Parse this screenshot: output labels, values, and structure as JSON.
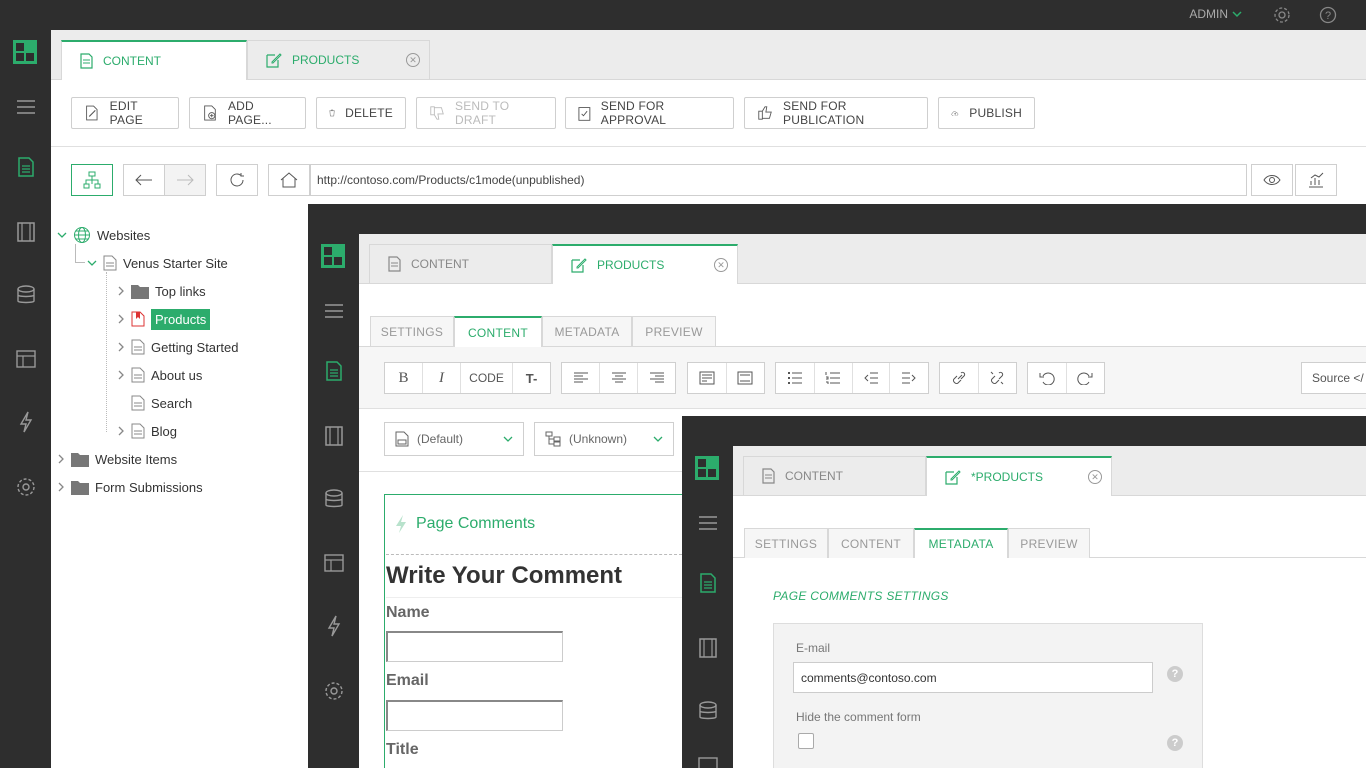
{
  "top": {
    "admin_label": "ADMIN"
  },
  "w1": {
    "tabs": [
      {
        "label": "CONTENT"
      },
      {
        "label": "PRODUCTS"
      }
    ],
    "toolbar": {
      "edit_page": "EDIT PAGE",
      "add_page": "ADD PAGE...",
      "delete": "DELETE",
      "send_to_draft": "SEND TO DRAFT",
      "send_for_approval": "SEND FOR APPROVAL",
      "send_for_publication": "SEND FOR PUBLICATION",
      "publish": "PUBLISH"
    },
    "address": "http://contoso.com/Products/c1mode(unpublished)",
    "tree": {
      "websites": "Websites",
      "venus": "Venus Starter Site",
      "top_links": "Top links",
      "products": "Products",
      "getting_started": "Getting Started",
      "about_us": "About us",
      "search": "Search",
      "blog": "Blog",
      "website_items": "Website Items",
      "form_submissions": "Form Submissions"
    }
  },
  "w2": {
    "tabs": [
      {
        "label": "CONTENT"
      },
      {
        "label": "PRODUCTS"
      }
    ],
    "subtabs": [
      "SETTINGS",
      "CONTENT",
      "METADATA",
      "PREVIEW"
    ],
    "editor": {
      "code": "CODE",
      "source": "Source </"
    },
    "dropdowns": {
      "template": "(Default)",
      "layout": "(Unknown)"
    },
    "preview": {
      "widget_title": "Page Comments",
      "heading": "Write Your Comment",
      "name_label": "Name",
      "email_label": "Email",
      "title_label": "Title"
    }
  },
  "w3": {
    "tabs": [
      {
        "label": "CONTENT"
      },
      {
        "label": "*PRODUCTS"
      }
    ],
    "subtabs": [
      "SETTINGS",
      "CONTENT",
      "METADATA",
      "PREVIEW"
    ],
    "section_title": "PAGE COMMENTS SETTINGS",
    "email_label": "E-mail",
    "email_value": "comments@contoso.com",
    "hide_label": "Hide the comment form"
  },
  "colors": {
    "accent": "#2cac6c",
    "dark": "#2e2e2e"
  }
}
